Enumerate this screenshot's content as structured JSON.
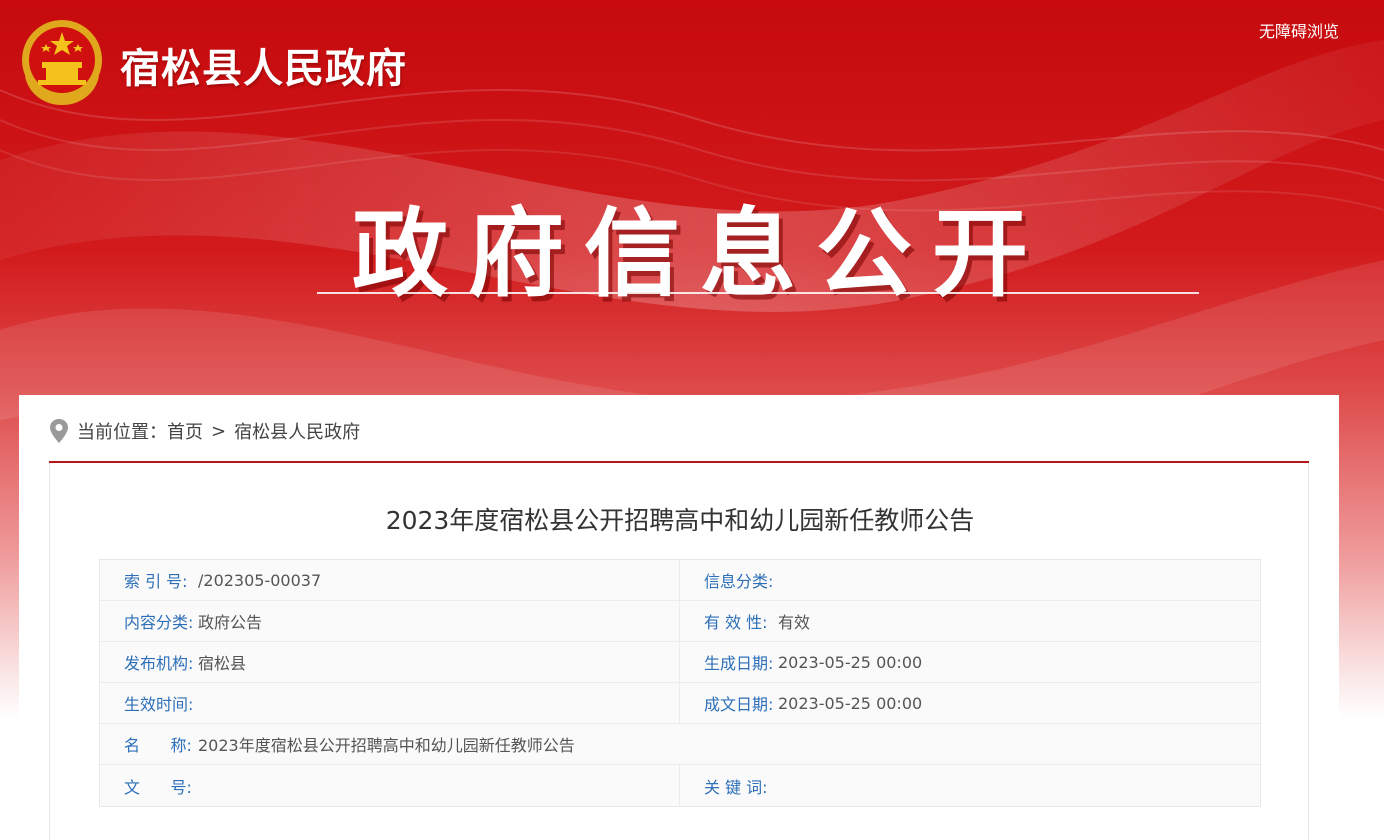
{
  "header": {
    "site_title": "宿松县人民政府",
    "accessibility_link": "无障碍浏览",
    "hero_title": "政府信息公开"
  },
  "breadcrumb": {
    "prefix": "当前位置：",
    "home": "首页",
    "separator": ">",
    "current": "宿松县人民政府"
  },
  "article": {
    "title": "2023年度宿松县公开招聘高中和幼儿园新任教师公告"
  },
  "meta": {
    "index_label": "索 引 号:",
    "index_value": "/202305-00037",
    "info_category_label": "信息分类:",
    "info_category_value": "",
    "content_category_label": "内容分类:",
    "content_category_value": "政府公告",
    "validity_label": "有 效 性:",
    "validity_value": "有效",
    "publisher_label": "发布机构:",
    "publisher_value": "宿松县",
    "generated_date_label": "生成日期:",
    "generated_date_value": "2023-05-25 00:00",
    "effective_time_label": "生效时间:",
    "effective_time_value": "",
    "written_date_label": "成文日期:",
    "written_date_value": "2023-05-25 00:00",
    "name_label": "名      称:",
    "name_value": "2023年度宿松县公开招聘高中和幼儿园新任教师公告",
    "doc_number_label": "文      号:",
    "doc_number_value": "",
    "keywords_label": "关 键 词:",
    "keywords_value": ""
  },
  "colors": {
    "banner_red": "#c60a0d",
    "rule_red": "#b8151b",
    "label_blue": "#2d6fb8"
  },
  "icons": {
    "emblem": "national-emblem-icon",
    "location": "location-pin-icon"
  }
}
